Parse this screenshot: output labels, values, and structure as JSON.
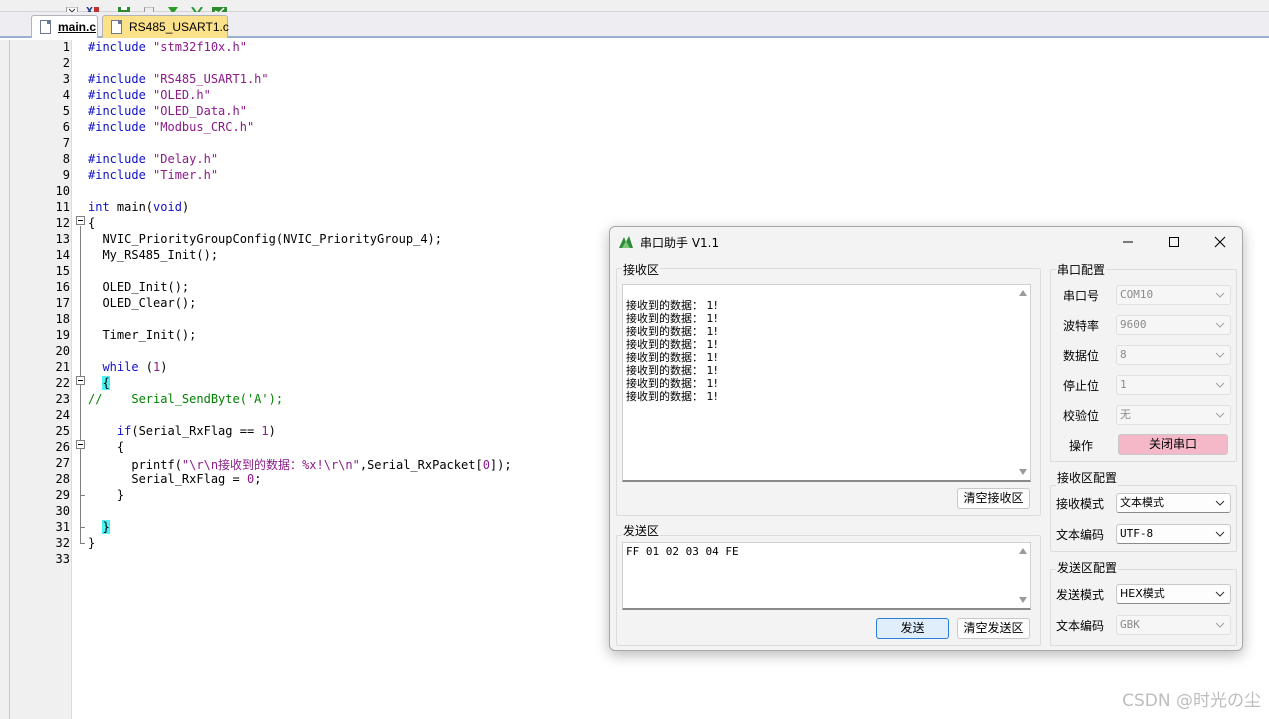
{
  "tabs": [
    {
      "label": "main.c",
      "active": true
    },
    {
      "label": "RS485_USART1.c",
      "active": false
    }
  ],
  "code_lines": [
    {
      "n": "1"
    },
    {
      "n": "2"
    },
    {
      "n": "3"
    },
    {
      "n": "4"
    },
    {
      "n": "5"
    },
    {
      "n": "6"
    },
    {
      "n": "7"
    },
    {
      "n": "8"
    },
    {
      "n": "9"
    },
    {
      "n": "10"
    },
    {
      "n": "11"
    },
    {
      "n": "12"
    },
    {
      "n": "13"
    },
    {
      "n": "14"
    },
    {
      "n": "15"
    },
    {
      "n": "16"
    },
    {
      "n": "17"
    },
    {
      "n": "18"
    },
    {
      "n": "19"
    },
    {
      "n": "20"
    },
    {
      "n": "21"
    },
    {
      "n": "22"
    },
    {
      "n": "23"
    },
    {
      "n": "24"
    },
    {
      "n": "25"
    },
    {
      "n": "26"
    },
    {
      "n": "27"
    },
    {
      "n": "28"
    },
    {
      "n": "29"
    },
    {
      "n": "30"
    },
    {
      "n": "31"
    },
    {
      "n": "32"
    },
    {
      "n": "33"
    }
  ],
  "code": {
    "l1_kw": "#include",
    "l1_str": "\"stm32f10x.h\"",
    "l3_kw": "#include",
    "l3_str": "\"RS485_USART1.h\"",
    "l4_kw": "#include",
    "l4_str": "\"OLED.h\"",
    "l5_kw": "#include",
    "l5_str": "\"OLED_Data.h\"",
    "l6_kw": "#include",
    "l6_str": "\"Modbus_CRC.h\"",
    "l8_kw": "#include",
    "l8_str": "\"Delay.h\"",
    "l9_kw": "#include",
    "l9_str": "\"Timer.h\"",
    "l11_int": "int",
    "l11_mid": " main(",
    "l11_void": "void",
    "l11_end": ")",
    "l12": "{",
    "l13": "  NVIC_PriorityGroupConfig(NVIC_PriorityGroup_4);",
    "l14": "  My_RS485_Init();",
    "l16": "  OLED_Init();",
    "l17": "  OLED_Clear();",
    "l19": "  Timer_Init();",
    "l21_kw": "while",
    "l21_mid": " (",
    "l21_num": "1",
    "l21_end": ")",
    "l22": "{",
    "l23": "//    Serial_SendByte('A');",
    "l25_if": "if",
    "l25_mid": "(Serial_RxFlag == ",
    "l25_num": "1",
    "l25_end": ")",
    "l26": "    {",
    "l27_pre": "      printf(",
    "l27_str1": "\"\\r\\n",
    "l27_cn": "接收到的数据：",
    "l27_str2": "%x!\\r\\n\"",
    "l27_end": ",Serial_RxPacket[",
    "l27_num": "0",
    "l27_end2": "]);",
    "l28_pre": "      Serial_RxFlag = ",
    "l28_num": "0",
    "l28_end": ";",
    "l29": "    }",
    "l31": "}",
    "l32": "}"
  },
  "serial": {
    "title": "串口助手 V1.1",
    "recv_group": "接收区",
    "recv_lines": [
      "接收到的数据： 1!",
      "接收到的数据： 1!",
      "接收到的数据： 1!",
      "接收到的数据： 1!",
      "接收到的数据： 1!",
      "接收到的数据： 1!",
      "接收到的数据： 1!",
      "接收到的数据： 1!"
    ],
    "clear_recv": "清空接收区",
    "send_group": "发送区",
    "send_text": "FF 01 02 03 04 FE",
    "send_btn": "发送",
    "clear_send": "清空发送区",
    "port_group": "串口配置",
    "port_label": "串口号",
    "port_value": "COM10",
    "baud_label": "波特率",
    "baud_value": "9600",
    "data_label": "数据位",
    "data_value": "8",
    "stop_label": "停止位",
    "stop_value": "1",
    "parity_label": "校验位",
    "parity_value": "无",
    "op_label": "操作",
    "op_btn": "关闭串口",
    "recv_cfg_group": "接收区配置",
    "recv_mode_label": "接收模式",
    "recv_mode_value": "文本模式",
    "recv_enc_label": "文本编码",
    "recv_enc_value": "UTF-8",
    "send_cfg_group": "发送区配置",
    "send_mode_label": "发送模式",
    "send_mode_value": "HEX模式",
    "send_enc_label": "文本编码",
    "send_enc_value": "GBK"
  },
  "watermark": "CSDN @时光の尘"
}
